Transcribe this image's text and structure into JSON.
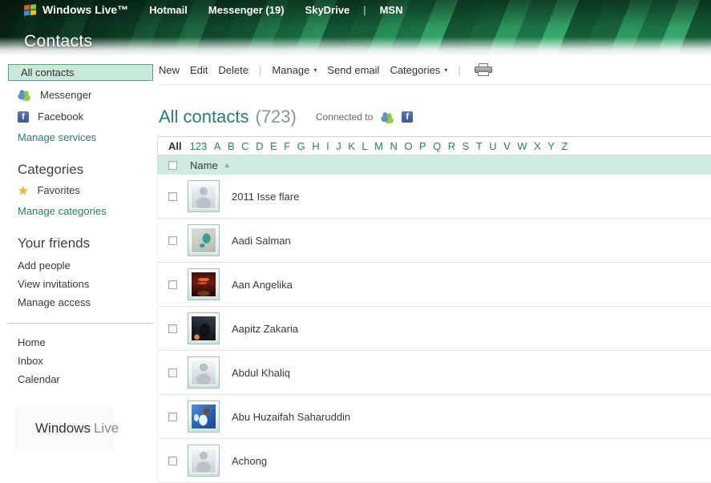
{
  "topnav": {
    "brand": "Windows Live™",
    "links": [
      "Hotmail",
      "Messenger (19)",
      "SkyDrive",
      "MSN"
    ],
    "separator": "|"
  },
  "banner": {
    "title": "Contacts"
  },
  "sidebar": {
    "all_contacts": "All contacts",
    "services": [
      {
        "label": "Messenger",
        "icon": "messenger-icon"
      },
      {
        "label": "Facebook",
        "icon": "facebook-icon"
      }
    ],
    "manage_services": "Manage services",
    "categories_heading": "Categories",
    "favorites": {
      "label": "Favorites",
      "icon": "star-icon"
    },
    "manage_categories": "Manage categories",
    "friends_heading": "Your friends",
    "friend_links": [
      "Add people",
      "View invitations",
      "Manage access"
    ],
    "nav_links": [
      "Home",
      "Inbox",
      "Calendar"
    ],
    "footer_logo": {
      "windows": "Windows",
      "live": "Live"
    }
  },
  "toolbar": {
    "new": "New",
    "edit": "Edit",
    "delete": "Delete",
    "manage": "Manage",
    "send_email": "Send email",
    "categories": "Categories",
    "separator": "|",
    "dropdown_glyph": "▾",
    "print_icon": "printer-icon"
  },
  "main": {
    "title": "All contacts",
    "count": "(723)",
    "connected_to_label": "Connected to",
    "connected_icons": [
      "messenger-icon",
      "facebook-icon"
    ],
    "alphabet": {
      "all": "All",
      "filters": [
        "123",
        "A",
        "B",
        "C",
        "D",
        "E",
        "F",
        "G",
        "H",
        "I",
        "J",
        "K",
        "L",
        "M",
        "N",
        "O",
        "P",
        "Q",
        "R",
        "S",
        "T",
        "U",
        "V",
        "W",
        "X",
        "Y",
        "Z"
      ]
    },
    "table": {
      "name_header": "Name",
      "sort_glyph": "▲"
    },
    "contacts": [
      {
        "name": "2011 Isse flare",
        "avatar": "default"
      },
      {
        "name": "Aadi Salman",
        "avatar": "map"
      },
      {
        "name": "Aan Angelika",
        "avatar": "rock"
      },
      {
        "name": "Aapitz Zakaria",
        "avatar": "silhouette"
      },
      {
        "name": "Abdul Khaliq",
        "avatar": "default"
      },
      {
        "name": "Abu Huzaifah Saharuddin",
        "avatar": "anime"
      },
      {
        "name": "Achong",
        "avatar": "default"
      }
    ]
  },
  "glyphs": {
    "facebook_f": "f",
    "star": "★"
  },
  "colors": {
    "accent_teal": "#2B7D6D",
    "selected_bg": "#C9E9DA",
    "selected_border": "#56A08C",
    "table_header_bg": "#CDEBE0",
    "facebook_blue": "#3B5998",
    "star_gold": "#F0B63C",
    "banner_green": "#1E7A4B",
    "text_dark": "#3A3A3A",
    "count_gray": "#879690"
  }
}
